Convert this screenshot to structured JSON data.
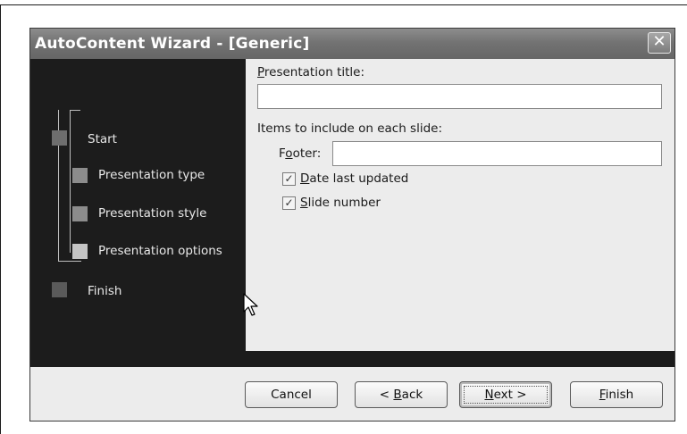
{
  "window": {
    "title": "AutoContent Wizard - [Generic]",
    "close_glyph": "✕"
  },
  "steps": [
    {
      "label": "Start",
      "color": "#6e6e6e"
    },
    {
      "label": "Presentation type",
      "color": "#8c8c8c"
    },
    {
      "label": "Presentation style",
      "color": "#8c8c8c"
    },
    {
      "label": "Presentation options",
      "color": "#c4c4c4"
    },
    {
      "label": "Finish",
      "color": "#5a5a5a"
    }
  ],
  "form": {
    "title_label": {
      "pre": "",
      "key": "P",
      "post": "resentation title:"
    },
    "title_value": "",
    "items_label": "Items to include on each slide:",
    "footer_label": {
      "pre": "F",
      "key": "o",
      "post": "oter:"
    },
    "footer_value": "",
    "date_checkbox": {
      "checked": true,
      "key": "D",
      "post": "ate last updated"
    },
    "slide_checkbox": {
      "checked": true,
      "key": "S",
      "post": "lide number"
    }
  },
  "buttons": {
    "cancel": {
      "pre": "Cancel",
      "key": "",
      "post": ""
    },
    "back": {
      "pre": "< ",
      "key": "B",
      "post": "ack"
    },
    "next": {
      "pre": "",
      "key": "N",
      "post": "ext >"
    },
    "finish": {
      "pre": "",
      "key": "F",
      "post": "inish"
    }
  },
  "icons": {
    "close": "close-icon",
    "cursor": "mouse-pointer-icon",
    "check": "checkmark-icon"
  }
}
